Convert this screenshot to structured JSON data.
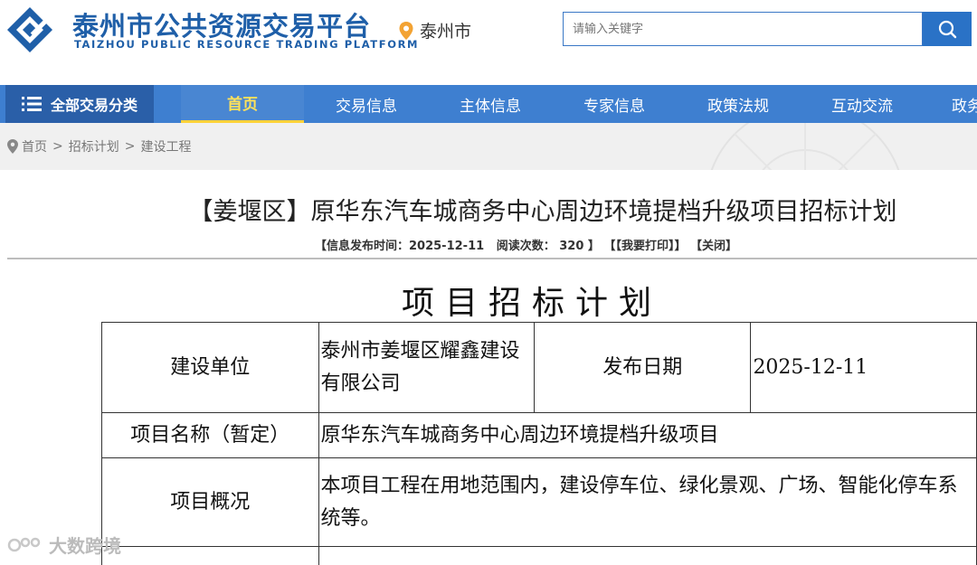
{
  "header": {
    "logo_cn": "泰州市公共资源交易平台",
    "logo_en": "TAIZHOU PUBLIC RESOURCE TRADING PLATFORM",
    "location_icon": "map-pin-icon",
    "city": "泰州市",
    "search_placeholder": "请输入关键字",
    "search_icon": "search-icon"
  },
  "nav": {
    "all_label": "全部交易分类",
    "all_icon": "list-icon",
    "items": [
      "首页",
      "交易信息",
      "主体信息",
      "专家信息",
      "政策法规",
      "互动交流",
      "政务"
    ],
    "active_index": 0
  },
  "breadcrumb": {
    "icon": "location-pin-icon",
    "items": [
      "首页",
      "招标计划",
      "建设工程"
    ],
    "separator": ">"
  },
  "article": {
    "title": "【姜堰区】原华东汽车城商务中心周边环境提档升级项目招标计划",
    "meta_publish": "【信息发布时间：2025-12-11   阅读次数： 320 】",
    "meta_print": "【【我要打印】】",
    "meta_close": "【关闭】"
  },
  "document": {
    "title": "项目招标计划",
    "rows": [
      {
        "label": "建设单位",
        "value": "泰州市姜堰区耀鑫建设有限公司",
        "label2": "发布日期",
        "value2": "2025-12-11"
      },
      {
        "label": "项目名称（暂定）",
        "value": "原华东汽车城商务中心周边环境提档升级项目"
      },
      {
        "label": "项目概况",
        "value": "本项目工程在用地范围内，建设停车位、绿化景观、广场、智能化停车系统等。"
      }
    ]
  },
  "watermark": "大数跨境",
  "colors": {
    "brand_blue": "#1f5fa8",
    "nav_blue": "#3e7fd0",
    "nav_active": "#ffe15a"
  }
}
